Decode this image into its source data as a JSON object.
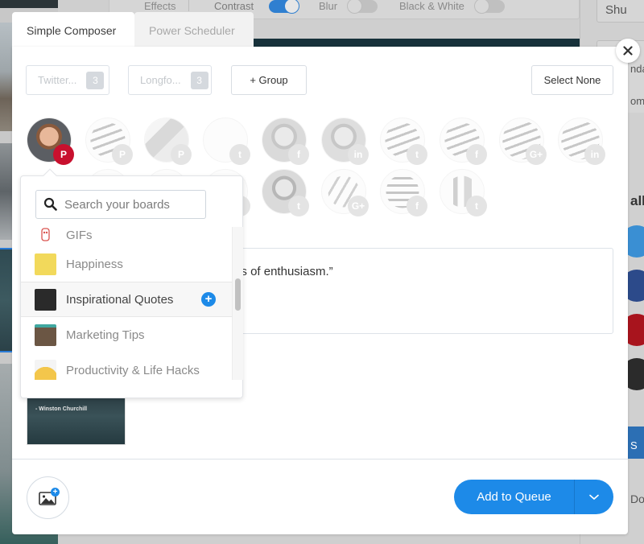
{
  "background": {
    "toolbar": {
      "effects_label": "Effects",
      "contrast_label": "Contrast",
      "contrast_on": true,
      "blur_label": "Blur",
      "blur_on": false,
      "bw_label": "Black & White",
      "bw_on": false
    },
    "right_panel": {
      "button_top": "Shu",
      "text_1": "nda",
      "text_2": "om",
      "heading": "all",
      "blue_button": "S",
      "button_bottom": "Do"
    }
  },
  "tabs": [
    {
      "label": "Simple Composer",
      "active": true
    },
    {
      "label": "Power Scheduler",
      "active": false
    }
  ],
  "groups": [
    {
      "label": "Twitter...",
      "count": "3"
    },
    {
      "label": "Longfo...",
      "count": "3"
    }
  ],
  "add_group_label": "+ Group",
  "select_none_label": "Select None",
  "profiles": [
    {
      "name": "profile-photo-man",
      "network": "pinterest",
      "badge": "P",
      "selected": true
    },
    {
      "name": "profile-buffer-logo",
      "network": "pinterest",
      "badge": "P",
      "selected": false
    },
    {
      "name": "profile-illustration",
      "network": "pinterest",
      "badge": "P",
      "selected": false
    },
    {
      "name": "profile-blank",
      "network": "twitter",
      "badge": "t",
      "selected": false
    },
    {
      "name": "profile-photo-man",
      "network": "facebook",
      "badge": "f",
      "selected": false
    },
    {
      "name": "profile-photo-man",
      "network": "linkedin",
      "badge": "in",
      "selected": false
    },
    {
      "name": "profile-buffer-logo",
      "network": "twitter",
      "badge": "t",
      "selected": false
    },
    {
      "name": "profile-buffer-logo",
      "network": "facebook",
      "badge": "f",
      "selected": false
    },
    {
      "name": "profile-buffer-logo",
      "network": "google-plus",
      "badge": "G+",
      "selected": false
    },
    {
      "name": "profile-buffer-logo",
      "network": "linkedin",
      "badge": "in",
      "selected": false
    },
    {
      "name": "profile-photo-young-man",
      "network": "twitter",
      "badge": "t",
      "selected": false
    },
    {
      "name": "profile-slashes-logo",
      "network": "google-plus",
      "badge": "G+",
      "selected": false
    },
    {
      "name": "profile-lines-logo",
      "network": "facebook",
      "badge": "f",
      "selected": false
    },
    {
      "name": "profile-if-logo",
      "network": "twitter",
      "badge": "t",
      "selected": false
    }
  ],
  "board_picker": {
    "search_placeholder": "Search your boards",
    "boards": [
      {
        "name": "GIFs",
        "thumb_color": "#ffffff",
        "hovered": false
      },
      {
        "name": "Happiness",
        "thumb_color": "#f2d95b",
        "hovered": false
      },
      {
        "name": "Inspirational Quotes",
        "thumb_color": "#2a2a2a",
        "hovered": true
      },
      {
        "name": "Marketing Tips",
        "thumb_color": "#5a4636",
        "hovered": false
      },
      {
        "name": "Productivity & Life Hacks",
        "thumb_color": "#f3c64b",
        "hovered": false
      }
    ]
  },
  "editor": {
    "visible_text": "o failure with no loss of enthusiasm.”"
  },
  "media": {
    "thumb_caption": "- Winston Churchill"
  },
  "footer": {
    "add_to_queue_label": "Add to Queue"
  },
  "colors": {
    "accent": "#1d8ae8",
    "pinterest": "#c8102e"
  }
}
